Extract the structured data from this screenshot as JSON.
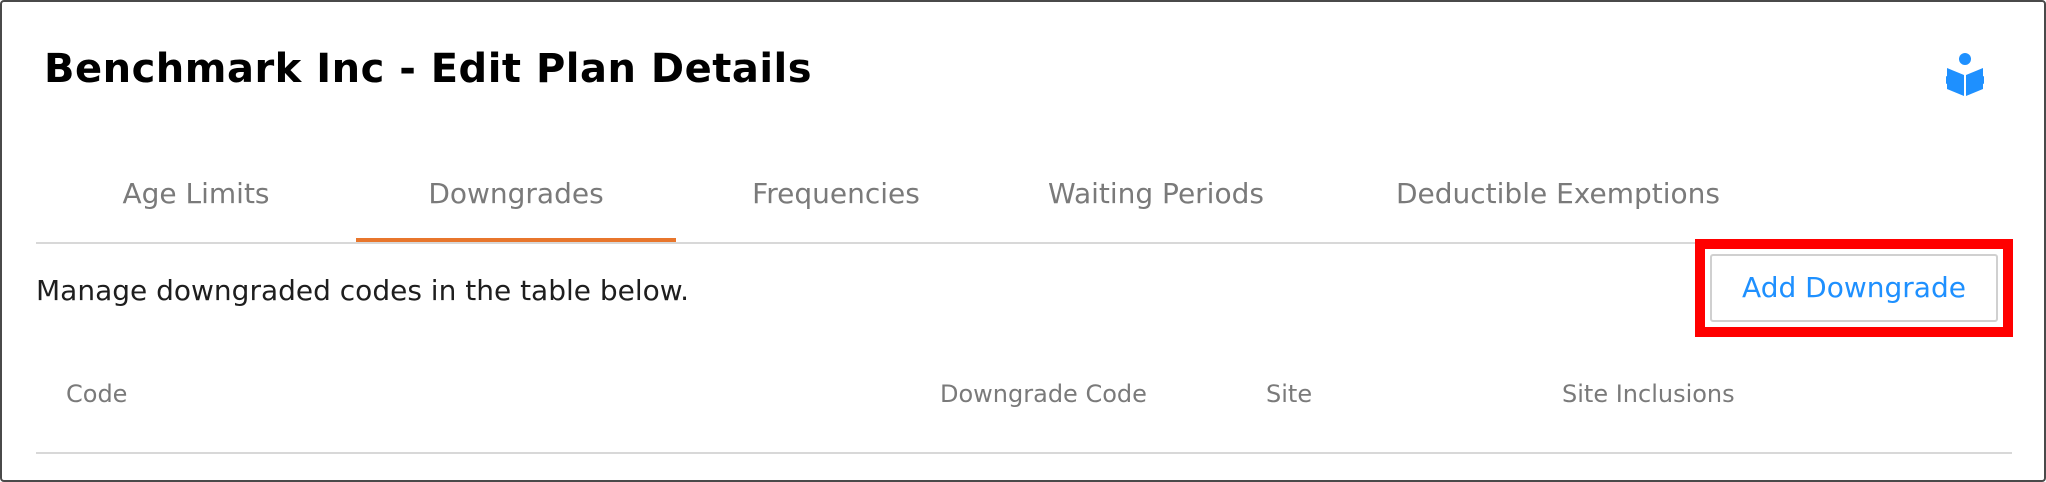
{
  "header": {
    "title": "Benchmark Inc - Edit Plan Details",
    "help_icon": "book-reader-icon"
  },
  "tabs": [
    {
      "label": "Age Limits",
      "active": false
    },
    {
      "label": "Downgrades",
      "active": true
    },
    {
      "label": "Frequencies",
      "active": false
    },
    {
      "label": "Waiting Periods",
      "active": false
    },
    {
      "label": "Deductible Exemptions",
      "active": false
    }
  ],
  "main": {
    "instructions": "Manage downgraded codes in the table below.",
    "add_button_label": "Add Downgrade",
    "table": {
      "columns": [
        "Code",
        "Downgrade Code",
        "Site",
        "Site Inclusions"
      ],
      "rows": []
    }
  },
  "colors": {
    "active_tab_underline": "#e8762c",
    "button_text": "#1e90ff",
    "highlight": "#ff0000",
    "help_icon": "#1e90ff"
  }
}
